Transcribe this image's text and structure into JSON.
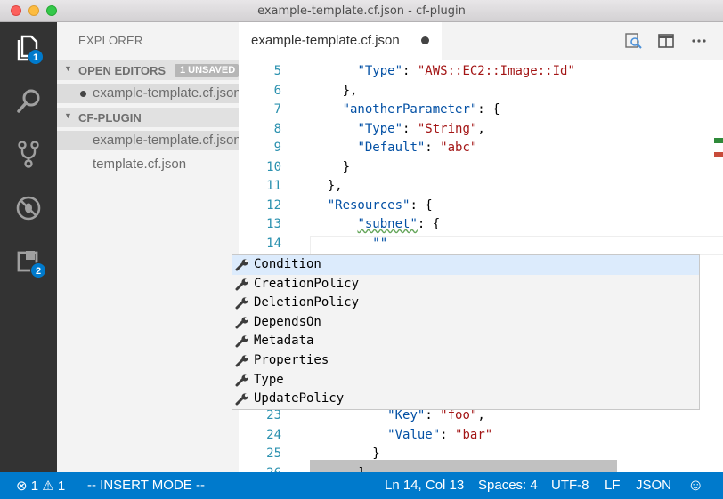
{
  "window": {
    "title": "example-template.cf.json - cf-plugin"
  },
  "activity": {
    "explorer_badge": "1",
    "extensions_badge": "2"
  },
  "sidebar": {
    "title": "EXPLORER",
    "open_editors": {
      "label": "OPEN EDITORS",
      "badge": "1 UNSAVED",
      "items": [
        {
          "name": "example-template.cf.json",
          "dirty": true
        }
      ]
    },
    "project": {
      "label": "CF-PLUGIN",
      "items": [
        {
          "name": "example-template.cf.json"
        },
        {
          "name": "template.cf.json"
        }
      ]
    }
  },
  "tab": {
    "label": "example-template.cf.json"
  },
  "editor": {
    "gutter": [
      "5",
      "6",
      "7",
      "8",
      "9",
      "10",
      "11",
      "12",
      "13",
      "14",
      "",
      "",
      "",
      "",
      "",
      "",
      "",
      "",
      "23",
      "24",
      "25",
      "26"
    ],
    "lines": [
      {
        "indent": "        ",
        "parts": [
          {
            "t": "\"Type\"",
            "c": "k"
          },
          {
            "t": ": ",
            "c": ""
          },
          {
            "t": "\"AWS::EC2::Image::Id\"",
            "c": "s"
          }
        ]
      },
      {
        "indent": "      ",
        "parts": [
          {
            "t": "},",
            "c": ""
          }
        ]
      },
      {
        "indent": "      ",
        "parts": [
          {
            "t": "\"anotherParameter\"",
            "c": "k"
          },
          {
            "t": ": {",
            "c": ""
          }
        ]
      },
      {
        "indent": "        ",
        "parts": [
          {
            "t": "\"Type\"",
            "c": "k"
          },
          {
            "t": ": ",
            "c": ""
          },
          {
            "t": "\"String\"",
            "c": "s"
          },
          {
            "t": ",",
            "c": ""
          }
        ]
      },
      {
        "indent": "        ",
        "parts": [
          {
            "t": "\"Default\"",
            "c": "k"
          },
          {
            "t": ": ",
            "c": ""
          },
          {
            "t": "\"abc\"",
            "c": "s"
          }
        ]
      },
      {
        "indent": "      ",
        "parts": [
          {
            "t": "}",
            "c": ""
          }
        ]
      },
      {
        "indent": "    ",
        "parts": [
          {
            "t": "},",
            "c": ""
          }
        ]
      },
      {
        "indent": "    ",
        "parts": [
          {
            "t": "\"Resources\"",
            "c": "k"
          },
          {
            "t": ": {",
            "c": ""
          }
        ]
      },
      {
        "indent": "        ",
        "parts": [
          {
            "t": "\"subnet\"",
            "c": "k squiggle"
          },
          {
            "t": ": {",
            "c": ""
          }
        ]
      },
      {
        "indent": "          ",
        "parts": [
          {
            "t": "\"\"",
            "c": "k"
          }
        ]
      },
      null,
      null,
      null,
      null,
      null,
      null,
      null,
      null,
      {
        "indent": "            ",
        "parts": [
          {
            "t": "\"Key\"",
            "c": "k"
          },
          {
            "t": ": ",
            "c": ""
          },
          {
            "t": "\"foo\"",
            "c": "s"
          },
          {
            "t": ",",
            "c": ""
          }
        ]
      },
      {
        "indent": "            ",
        "parts": [
          {
            "t": "\"Value\"",
            "c": "k"
          },
          {
            "t": ": ",
            "c": ""
          },
          {
            "t": "\"bar\"",
            "c": "s"
          }
        ]
      },
      {
        "indent": "          ",
        "parts": [
          {
            "t": "}",
            "c": ""
          }
        ]
      },
      {
        "indent": "        ",
        "parts": [
          {
            "t": "]",
            "c": ""
          }
        ]
      }
    ]
  },
  "suggest": {
    "items": [
      "Condition",
      "CreationPolicy",
      "DeletionPolicy",
      "DependsOn",
      "Metadata",
      "Properties",
      "Type",
      "UpdatePolicy"
    ],
    "focused_index": 0
  },
  "statusbar": {
    "errors": "1",
    "warnings": "1",
    "mode": "-- INSERT MODE --",
    "position": "Ln 14, Col 13",
    "spaces": "Spaces: 4",
    "encoding": "UTF-8",
    "eol": "LF",
    "language": "JSON"
  },
  "colors": {
    "accent": "#007acc",
    "activity_bg": "#333333",
    "sidebar_bg": "#f3f3f3",
    "key": "#0451a5",
    "string": "#a31515",
    "line_number": "#2b91af"
  }
}
